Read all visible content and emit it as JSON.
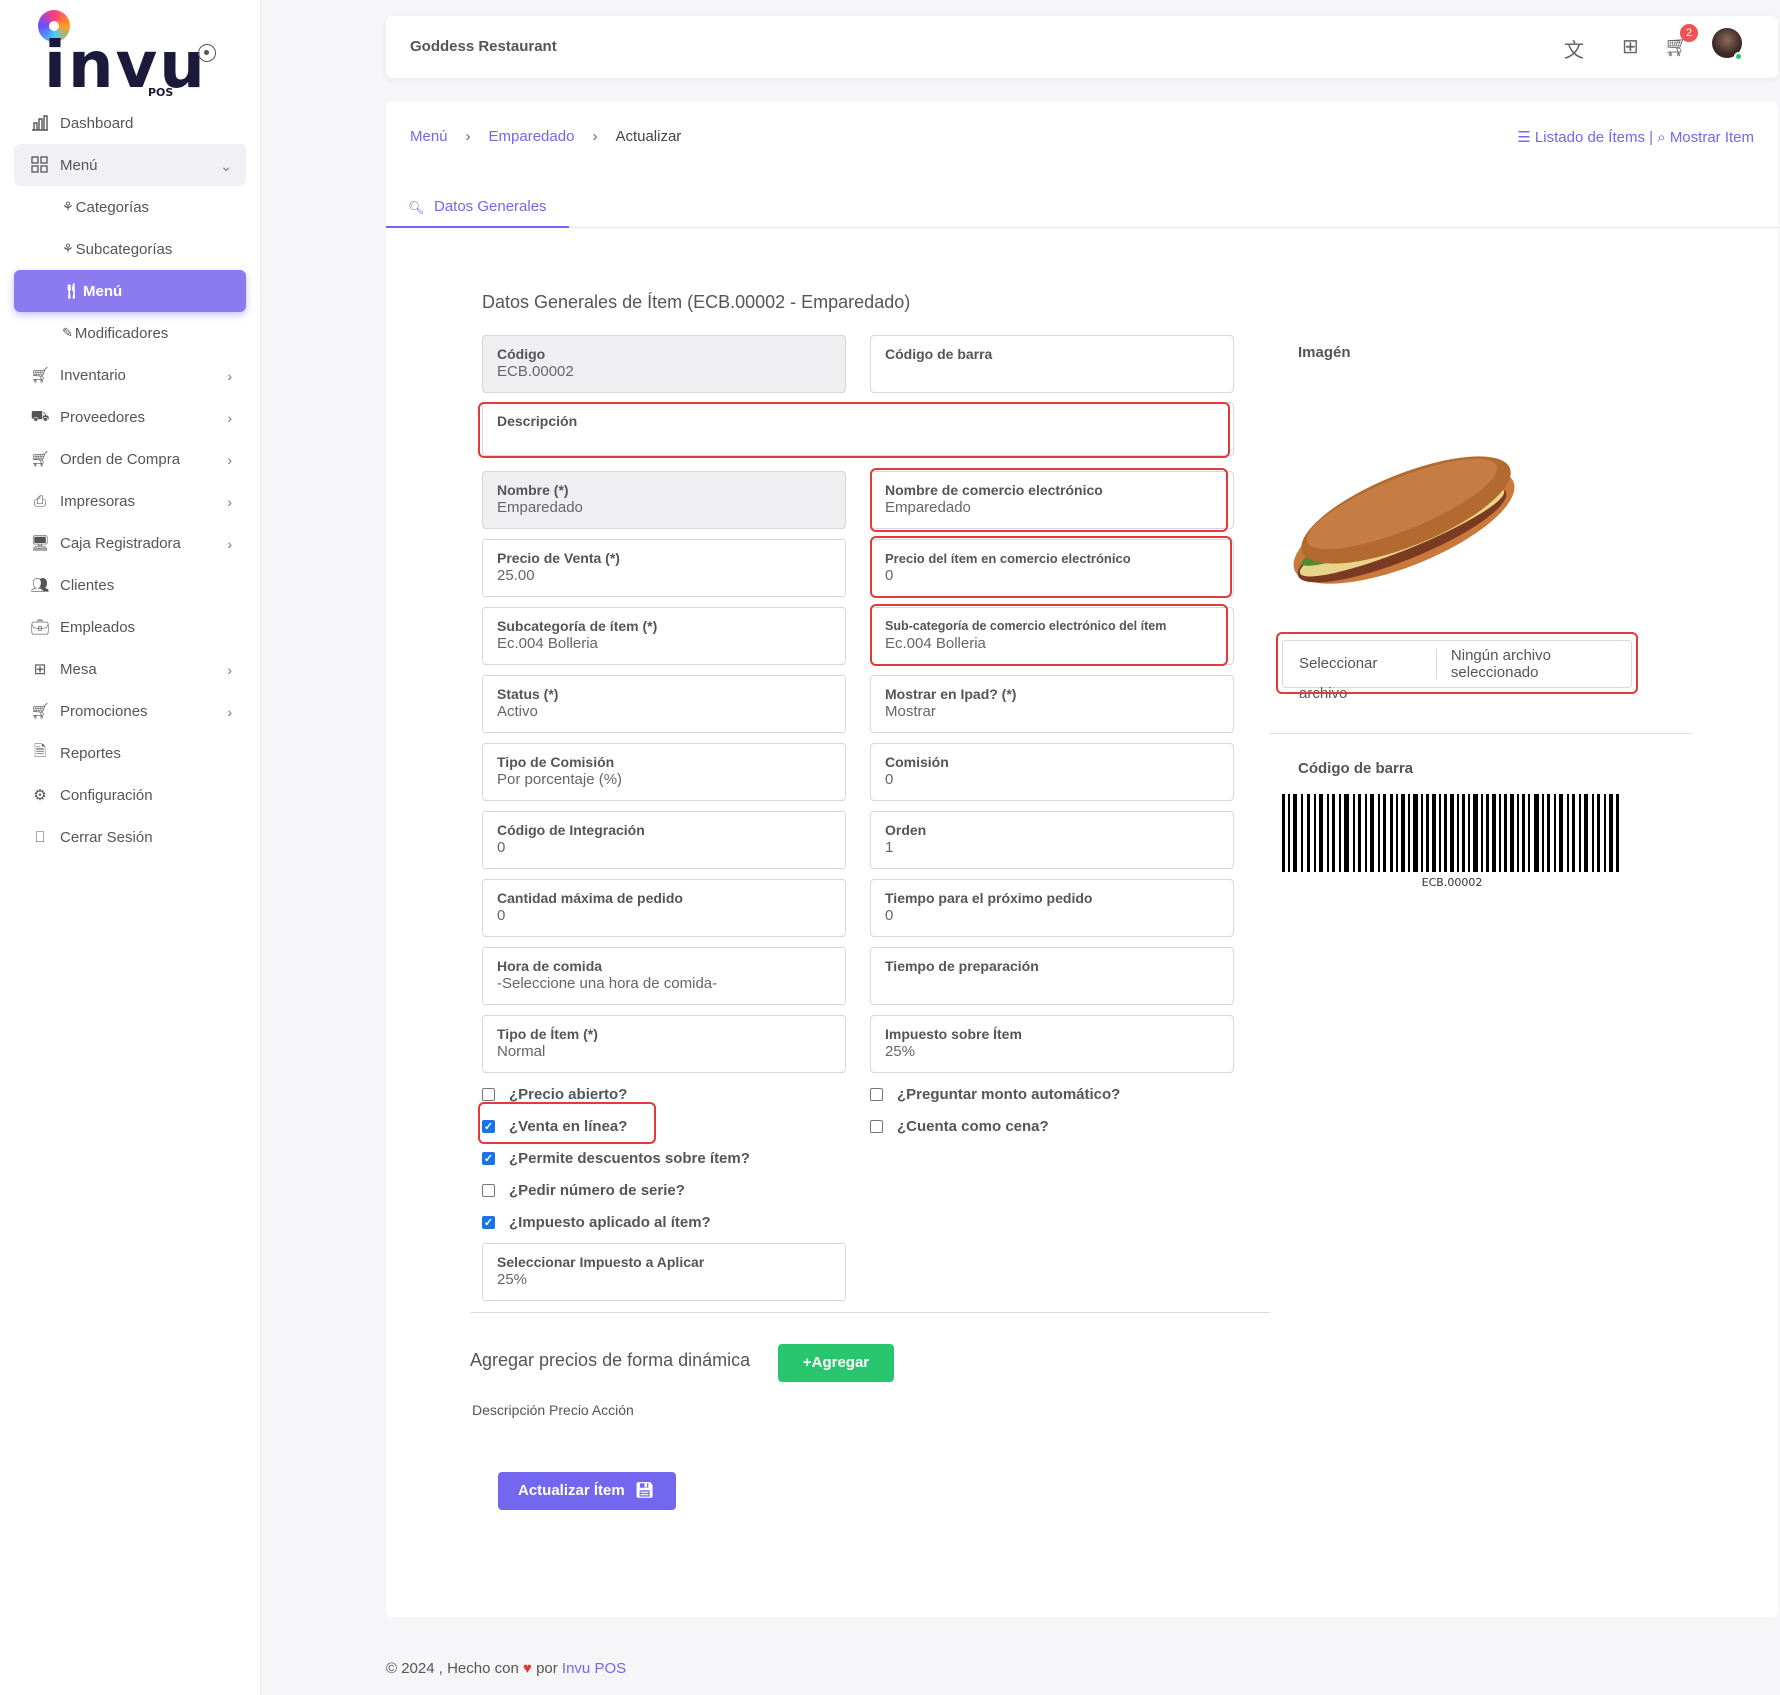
{
  "app": {
    "logo_text": "invu",
    "logo_sub": "POS"
  },
  "sidebar": {
    "items": [
      {
        "label": "Dashboard"
      },
      {
        "label": "Menú"
      },
      {
        "label": "Inventario"
      },
      {
        "label": "Proveedores"
      },
      {
        "label": "Orden de Compra"
      },
      {
        "label": "Impresoras"
      },
      {
        "label": "Caja Registradora"
      },
      {
        "label": "Clientes"
      },
      {
        "label": "Empleados"
      },
      {
        "label": "Mesa"
      },
      {
        "label": "Promociones"
      },
      {
        "label": "Reportes"
      },
      {
        "label": "Configuración"
      },
      {
        "label": "Cerrar Sesión"
      }
    ],
    "submenu": [
      {
        "label": "Categorías"
      },
      {
        "label": "Subcategorías"
      },
      {
        "label": "Menú"
      },
      {
        "label": "Modificadores"
      }
    ]
  },
  "header": {
    "title": "Goddess Restaurant",
    "cart_count": "2"
  },
  "breadcrumb": {
    "menu": "Menú",
    "item": "Emparedado",
    "current": "Actualizar"
  },
  "toplinks": {
    "list": "Listado de Ítems",
    "sep": "|",
    "show": "Mostrar Item"
  },
  "tab": {
    "label": "Datos Generales"
  },
  "form": {
    "title": "Datos Generales de Ítem (ECB.00002 - Emparedado)",
    "codigo": {
      "label": "Código",
      "value": "ECB.00002"
    },
    "codigo_barra": {
      "label": "Código de barra",
      "value": ""
    },
    "descripcion": {
      "label": "Descripción",
      "value": ""
    },
    "nombre": {
      "label": "Nombre (*)",
      "value": "Emparedado"
    },
    "nombre_ecommerce": {
      "label": "Nombre de comercio electrónico",
      "value": "Emparedado"
    },
    "precio_venta": {
      "label": "Precio de Venta (*)",
      "value": "25.00"
    },
    "precio_ecommerce": {
      "label": "Precio del ítem en comercio electrónico",
      "value": "0"
    },
    "subcategoria": {
      "label": "Subcategoría de ítem (*)",
      "value": "Ec.004 Bolleria"
    },
    "subcategoria_ecommerce": {
      "label": "Sub-categoría de comercio electrónico del ítem",
      "value": "Ec.004 Bolleria"
    },
    "status": {
      "label": "Status (*)",
      "value": "Activo"
    },
    "mostrar_ipad": {
      "label": "Mostrar en Ipad? (*)",
      "value": "Mostrar"
    },
    "tipo_comision": {
      "label": "Tipo de Comisión",
      "value": "Por porcentaje (%)"
    },
    "comision": {
      "label": "Comisión",
      "value": "0"
    },
    "codigo_integracion": {
      "label": "Código de Integración",
      "value": "0"
    },
    "orden": {
      "label": "Orden",
      "value": "1"
    },
    "cantidad_maxima": {
      "label": "Cantidad máxima de pedido",
      "value": "0"
    },
    "tiempo_proximo": {
      "label": "Tiempo para el próximo pedido",
      "value": "0"
    },
    "hora_comida": {
      "label": "Hora de comida",
      "value": "-Seleccione una hora de comida-"
    },
    "tiempo_preparacion": {
      "label": "Tiempo de preparación",
      "value": ""
    },
    "tipo_item": {
      "label": "Tipo de Ítem (*)",
      "value": "Normal"
    },
    "impuesto_item": {
      "label": "Impuesto sobre Ítem",
      "value": "25%"
    },
    "seleccionar_impuesto": {
      "label": "Seleccionar Impuesto a Aplicar",
      "value": "25%"
    }
  },
  "checkboxes": {
    "precio_abierto": {
      "label": "¿Precio abierto?",
      "checked": false
    },
    "venta_linea": {
      "label": "¿Venta en línea?",
      "checked": true
    },
    "permite_descuentos": {
      "label": "¿Permite descuentos sobre ítem?",
      "checked": true
    },
    "pedir_serie": {
      "label": "¿Pedir número de serie?",
      "checked": false
    },
    "impuesto_aplicado": {
      "label": "¿Impuesto aplicado al ítem?",
      "checked": true
    },
    "preguntar_monto": {
      "label": "¿Preguntar monto automático?",
      "checked": false
    },
    "cuenta_cena": {
      "label": "¿Cuenta como cena?",
      "checked": false
    }
  },
  "image": {
    "label": "Imagén",
    "select_button": "Seleccionar archivo",
    "file_status": "Ningún archivo seleccionado"
  },
  "barcode": {
    "label": "Código de barra",
    "code": "ECB.00002"
  },
  "dynamic": {
    "title": "Agregar precios de forma dinámica",
    "add_button": "+Agregar",
    "columns": "Descripción Precio Acción"
  },
  "actions": {
    "update": "Actualizar Ítem"
  },
  "footer": {
    "text": "© 2024 , Hecho con",
    "by": "por",
    "brand": "Invu POS"
  }
}
